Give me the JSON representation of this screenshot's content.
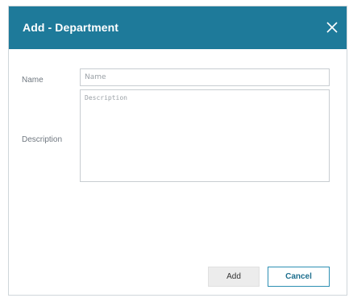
{
  "dialog": {
    "title": "Add - Department",
    "close_icon": "close-icon",
    "accent_color": "#1e7a9a"
  },
  "form": {
    "name_label": "Name",
    "name_placeholder": "Name",
    "name_value": "",
    "description_label": "Description",
    "description_placeholder": "Description",
    "description_value": ""
  },
  "buttons": {
    "add_label": "Add",
    "cancel_label": "Cancel"
  }
}
